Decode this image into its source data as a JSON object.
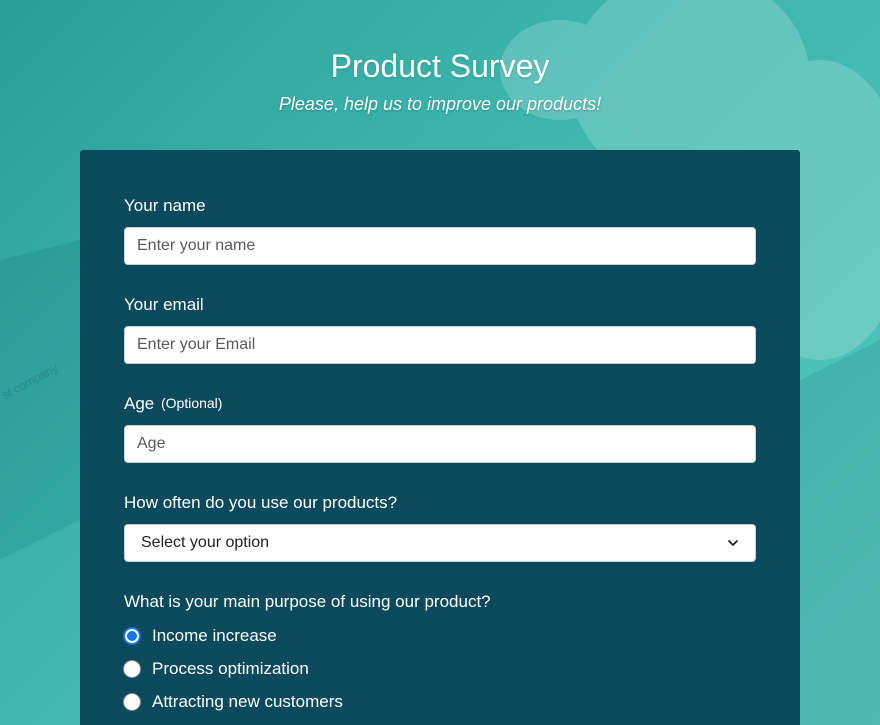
{
  "header": {
    "title": "Product Survey",
    "subtitle": "Please, help us to improve our products!"
  },
  "background": {
    "watermark_text": "st company"
  },
  "form": {
    "name": {
      "label": "Your name",
      "placeholder": "Enter your name"
    },
    "email": {
      "label": "Your email",
      "placeholder": "Enter your Email"
    },
    "age": {
      "label": "Age",
      "optional_note": "(Optional)",
      "placeholder": "Age"
    },
    "frequency": {
      "label": "How often do you use our products?",
      "selected": "Select your option"
    },
    "purpose": {
      "label": "What is your main purpose of using our product?",
      "options": [
        {
          "label": "Income increase",
          "checked": true
        },
        {
          "label": "Process optimization",
          "checked": false
        },
        {
          "label": "Attracting new customers",
          "checked": false
        }
      ]
    }
  },
  "colors": {
    "background_teal": "#3bb3ab",
    "card": "#0b495c",
    "radio_accent": "#1a73e8",
    "text": "#ffffff"
  }
}
